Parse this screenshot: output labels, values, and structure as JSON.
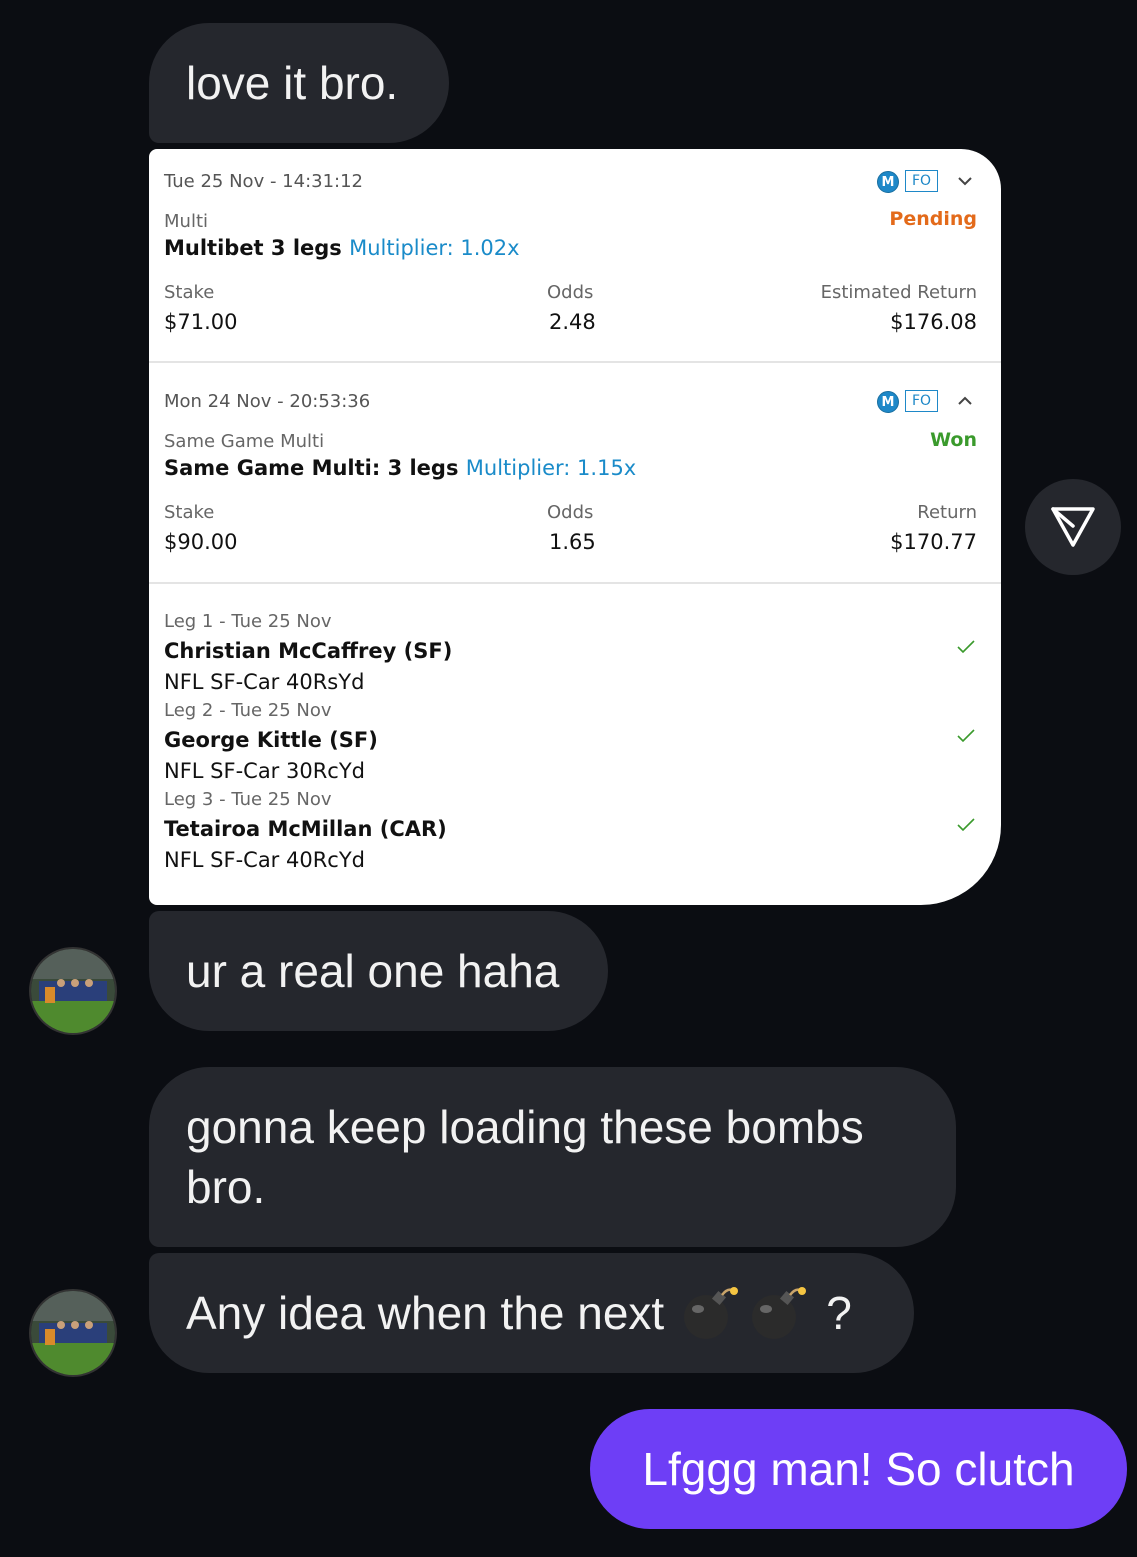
{
  "messages": {
    "m1": "love it bro.",
    "m2": "ur a real one haha",
    "m3_line1": "gonna keep loading these bombs",
    "m3_line2": "bro.",
    "m4_text": "Any idea when the next",
    "m4_end": "?",
    "m4_emoji": "bomb-emoji",
    "mine": "Lfggg man! So clutch"
  },
  "bets": [
    {
      "date": "Tue 25 Nov - 14:31:12",
      "badge_m": "M",
      "badge_fo": "FO",
      "type": "Multi",
      "status": "Pending",
      "title": "Multibet 3 legs",
      "multiplier": "Multiplier: 1.02x",
      "stake_label": "Stake",
      "stake": "$71.00",
      "odds_label": "Odds",
      "odds": "2.48",
      "return_label": "Estimated Return",
      "return": "$176.08",
      "chevron": "chevron-down-icon"
    },
    {
      "date": "Mon 24 Nov - 20:53:36",
      "badge_m": "M",
      "badge_fo": "FO",
      "type": "Same Game Multi",
      "status": "Won",
      "title": "Same Game Multi: 3 legs",
      "multiplier": "Multiplier: 1.15x",
      "stake_label": "Stake",
      "stake": "$90.00",
      "odds_label": "Odds",
      "odds": "1.65",
      "return_label": "Return",
      "return": "$170.77",
      "chevron": "chevron-up-icon"
    }
  ],
  "legs": [
    {
      "header": "Leg 1 - Tue 25 Nov",
      "player": "Christian McCaffrey (SF)",
      "market": "NFL SF-Car 40RsYd"
    },
    {
      "header": "Leg 2 - Tue 25 Nov",
      "player": "George Kittle (SF)",
      "market": "NFL SF-Car 30RcYd"
    },
    {
      "header": "Leg 3 - Tue 25 Nov",
      "player": "Tetairoa McMillan (CAR)",
      "market": "NFL SF-Car 40RcYd"
    }
  ],
  "colors": {
    "background": "#0b0d12",
    "bubble": "#25272d",
    "my_bubble": "#6e3ef6",
    "pending": "#e36a1a",
    "won": "#3a9a2c",
    "multiplier": "#1a8bc9"
  },
  "icons": {
    "send": "send-icon",
    "check": "check-icon"
  }
}
